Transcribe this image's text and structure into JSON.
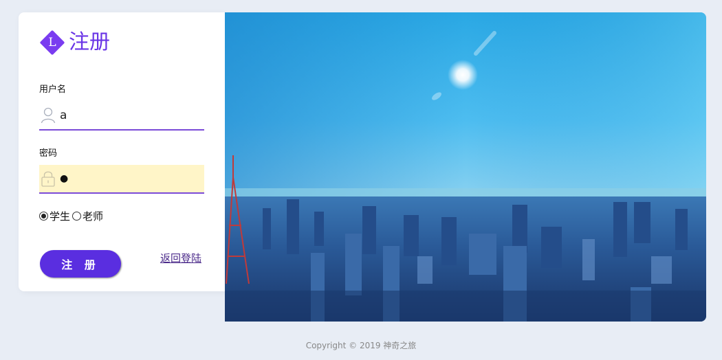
{
  "brand": {
    "logo_letter": "L",
    "title": "注册"
  },
  "form": {
    "username": {
      "label": "用户名",
      "value": "a",
      "icon": "user-icon"
    },
    "password": {
      "label": "密码",
      "value": "●",
      "icon": "lock-icon"
    },
    "roles": [
      {
        "label": "学生",
        "selected": true
      },
      {
        "label": "老师",
        "selected": false
      }
    ],
    "submit_label": "注 册",
    "back_link": "返回登陆"
  },
  "hero_image": {
    "icon": "city-skyline-photo"
  },
  "footer": {
    "copyright": "Copyright © 2019 神奇之旅"
  },
  "colors": {
    "accent": "#6a35e6",
    "button": "#5a2ee0",
    "background": "#e8edf5",
    "autofill": "#fff5c8"
  }
}
